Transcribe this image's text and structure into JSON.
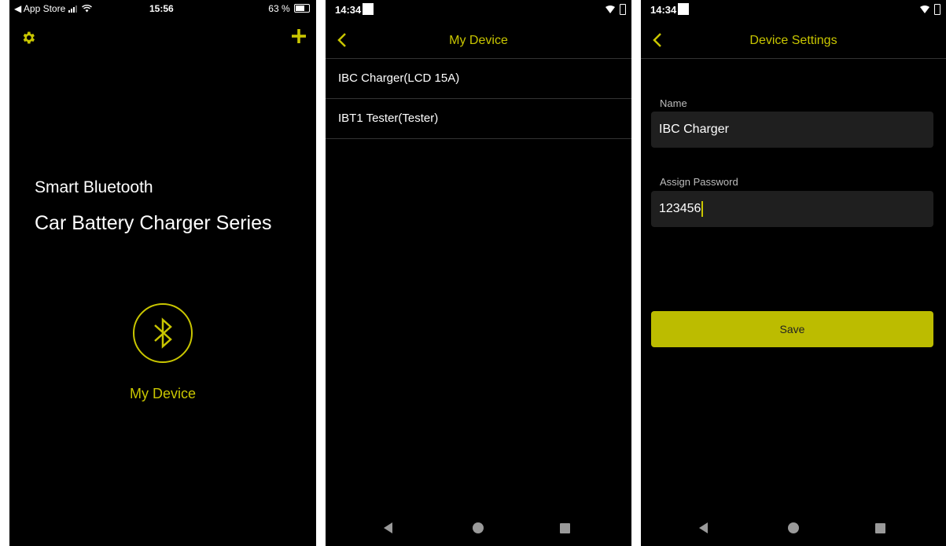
{
  "colors": {
    "accent": "#c9c600",
    "button": "#bcbc00",
    "background": "#000000",
    "divider": "#333333"
  },
  "screen1": {
    "status": {
      "carrier": "◀ App Store",
      "time": "15:56",
      "battery": "63 %"
    },
    "icons": {
      "settings": "gear-icon",
      "add": "plus-icon",
      "bluetooth": "bluetooth-icon"
    },
    "title_line1": "Smart Bluetooth",
    "title_line2": "Car Battery Charger Series",
    "my_device_label": "My Device"
  },
  "screen2": {
    "status": {
      "time": "14:34"
    },
    "header": {
      "title": "My Device",
      "back_icon": "chevron-left-icon"
    },
    "devices": [
      {
        "label": "IBC Charger(LCD 15A)"
      },
      {
        "label": "IBT1 Tester(Tester)"
      }
    ]
  },
  "screen3": {
    "status": {
      "time": "14:34"
    },
    "header": {
      "title": "Device Settings",
      "back_icon": "chevron-left-icon"
    },
    "name_label": "Name",
    "name_value": "IBC Charger",
    "password_label": "Assign Password",
    "password_value": "123456",
    "save_label": "Save"
  }
}
